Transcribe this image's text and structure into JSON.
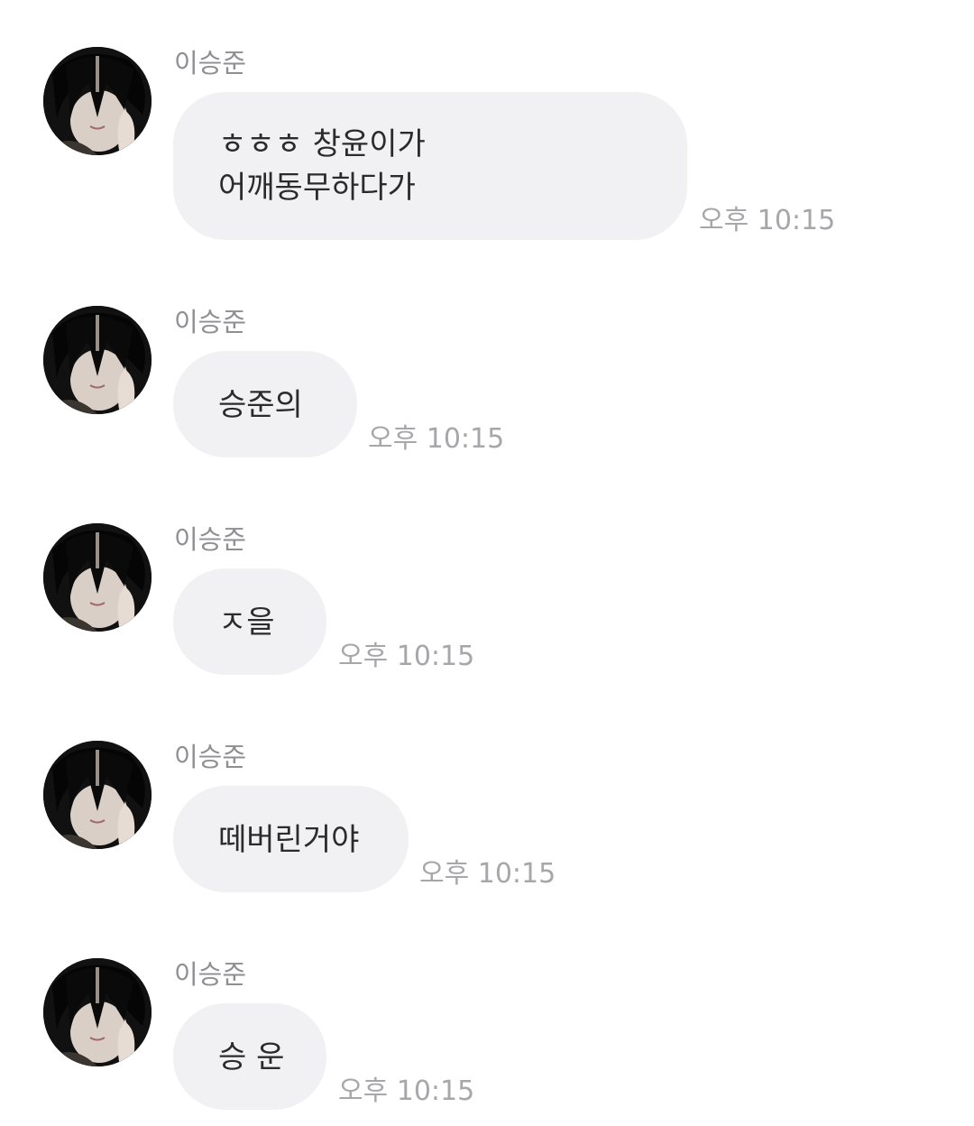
{
  "messages": [
    {
      "sender": "이승준",
      "lines": [
        "ㅎㅎㅎ 창윤이가",
        "어깨동무하다가"
      ],
      "time": "오후 10:15"
    },
    {
      "sender": "이승준",
      "lines": [
        "승준의"
      ],
      "time": "오후 10:15"
    },
    {
      "sender": "이승준",
      "lines": [
        "ㅈ을"
      ],
      "time": "오후 10:15"
    },
    {
      "sender": "이승준",
      "lines": [
        "떼버린거야"
      ],
      "time": "오후 10:15"
    },
    {
      "sender": "이승준",
      "lines": [
        "승 운"
      ],
      "time": "오후 10:15"
    }
  ]
}
